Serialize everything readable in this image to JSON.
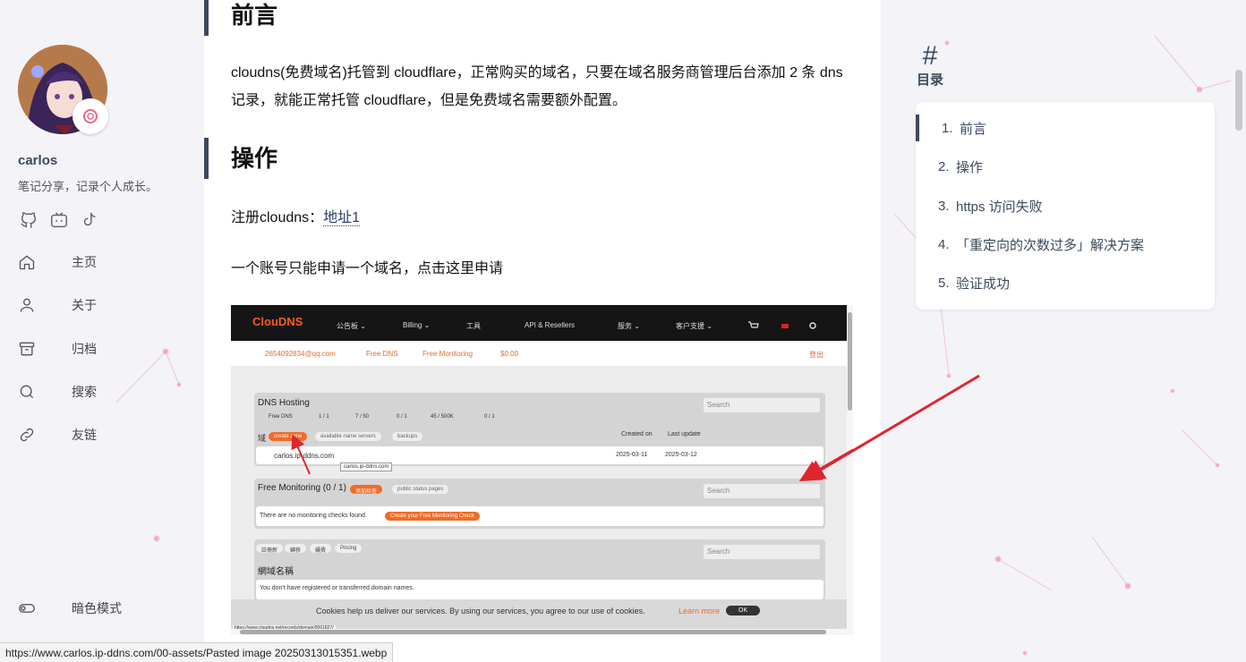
{
  "sidebar": {
    "username": "carlos",
    "motto": "笔记分享，记录个人成长。",
    "social_icons": [
      "github-icon",
      "bilibili-icon",
      "tiktok-icon"
    ],
    "nav": [
      {
        "icon": "home-icon",
        "label": "主页"
      },
      {
        "icon": "user-icon",
        "label": "关于"
      },
      {
        "icon": "archive-icon",
        "label": "归档"
      },
      {
        "icon": "search-icon",
        "label": "搜索"
      },
      {
        "icon": "link-icon",
        "label": "友链"
      }
    ],
    "dark_mode_label": "暗色模式"
  },
  "article": {
    "h_intro": "前言",
    "p_intro": "cloudns(免费域名)托管到 cloudflare，正常购买的域名，只要在域名服务商管理后台添加 2 条 dns 记录，就能正常托管 cloudflare，但是免费域名需要额外配置。",
    "h_ops": "操作",
    "reg_text": "注册cloudns：",
    "reg_link": "地址1",
    "one_account": "一个账号只能申请一个域名，点击这里申请"
  },
  "screenshot": {
    "logo": "ClouDNS",
    "menu": [
      "公告板 ⌄",
      "Billing ⌄",
      "工具",
      "API & Resellers",
      "服务 ⌄",
      "客户支援 ⌄"
    ],
    "email": "2654092834@qq.com",
    "free_dns": "Free DNS",
    "free_monitoring": "Free Monitoring",
    "balance": "$0.00",
    "logout": "登出",
    "dns_hosting": "DNS Hosting",
    "search": "Search",
    "stats": [
      "Free DNS",
      "1 / 1",
      "7 / 50",
      "0 / 1",
      "45 / 500K",
      "0 / 1"
    ],
    "domain_label": "域",
    "create_zone": "create zone",
    "available_ns": "available name servers",
    "backups": "backups",
    "created_on": "Created on",
    "last_update": "Last update",
    "zone_name": "carlos.ip-ddns.com",
    "zone_created": "2025-03-11",
    "zone_updated": "2025-03-12",
    "tooltip": "carlos.ip-ddns.com",
    "monitoring_title": "Free Monitoring (0 / 1)",
    "add_check": "添加检查",
    "public_status": "public status pages",
    "no_checks": "There are no monitoring checks found.",
    "create_check": "Create your Free Monitoring Check",
    "domain_tabs": [
      "註冊新",
      "轉移",
      "續費",
      "Pricing"
    ],
    "domain_names": "網域名稱",
    "no_domains": "You don't have registered or transferred domain names.",
    "cookie_text": "Cookies help us deliver our services. By using our services, you agree to our use of cookies.",
    "learn_more": "Learn more",
    "ok": "OK",
    "status_url": "https://www.cloudns.net/records/domain/9061827/"
  },
  "toc": {
    "header_symbol": "#",
    "header_label": "目录",
    "items": [
      {
        "num": "1.",
        "title": "前言"
      },
      {
        "num": "2.",
        "title": "操作"
      },
      {
        "num": "3.",
        "title": "https 访问失败"
      },
      {
        "num": "4.",
        "title": "「重定向的次数过多」解决方案"
      },
      {
        "num": "5.",
        "title": "验证成功"
      }
    ]
  },
  "statusbar": {
    "url": "https://www.carlos.ip-ddns.com/00-assets/Pasted image 20250313015351.webp"
  },
  "colors": {
    "accent": "#3c4a5e",
    "cloudns_orange": "#ff5a1f",
    "arrow_red": "#e0252d"
  }
}
